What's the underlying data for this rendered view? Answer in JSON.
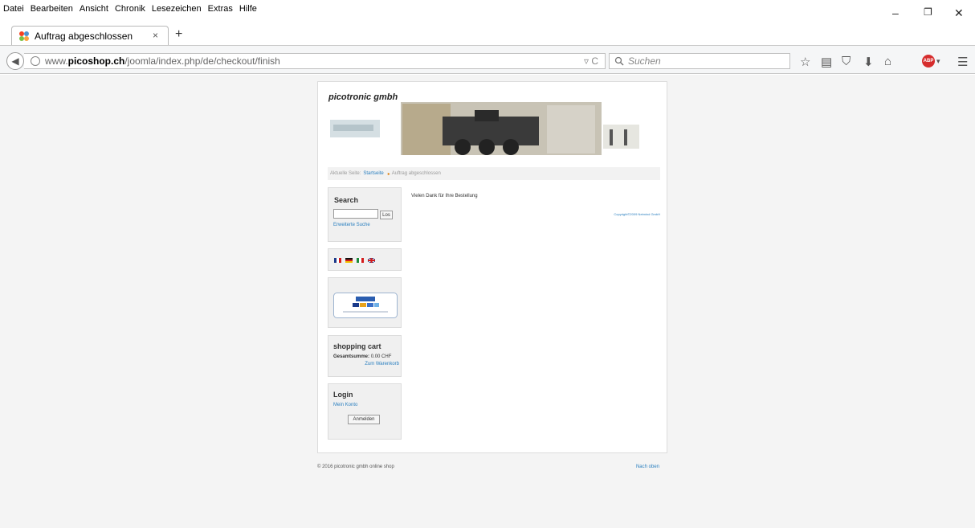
{
  "menubar": {
    "items": [
      "Datei",
      "Bearbeiten",
      "Ansicht",
      "Chronik",
      "Lesezeichen",
      "Extras",
      "Hilfe"
    ]
  },
  "tab": {
    "title": "Auftrag abgeschlossen",
    "close": "×",
    "new": "+"
  },
  "url": {
    "prefix": "www.",
    "host": "picoshop.ch",
    "path": "/joomla/index.php/de/checkout/finish"
  },
  "search_placeholder": "Suchen",
  "window_controls": {
    "minimize": "–",
    "restore": "❐",
    "close": "✕"
  },
  "site": {
    "brand": "picotronic gmbh",
    "breadcrumb": {
      "prefix": "Aktuelle Seite:",
      "home": "Startseite",
      "current": "Auftrag abgeschlossen"
    },
    "search_module": {
      "title": "Search",
      "button": "Los",
      "advanced": "Erweiterte Suche"
    },
    "cart_module": {
      "title": "shopping cart",
      "total_label": "Gesamtsumme:",
      "total_value": "0.00 CHF",
      "link": "Zum Warenkorb"
    },
    "login_module": {
      "title": "Login",
      "account_link": "Mein Konto",
      "button": "Anmelden"
    },
    "thanks": "Vielen Dank für Ihre Bestellung",
    "copyright": "Copyright©2009 Netmind GmbH",
    "footer_left": "© 2016 picotronic gmbh online shop",
    "footer_right": "Nach oben"
  }
}
